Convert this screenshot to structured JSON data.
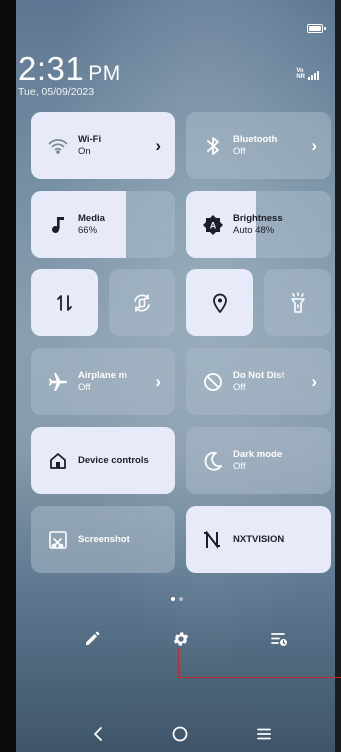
{
  "status_bar": {
    "time": "2:31",
    "ampm": "PM",
    "date": "Tue, 05/09/2023",
    "network": "VoNR"
  },
  "tiles": {
    "wifi": {
      "label": "Wi-Fi",
      "status": "On",
      "icon": "wifi-icon",
      "active": true
    },
    "bluetooth": {
      "label": "Bluetooth",
      "status": "Off",
      "icon": "bluetooth-icon",
      "active": false
    },
    "media": {
      "label": "Media",
      "value": "66%",
      "level": 0.66,
      "icon": "music-note-icon"
    },
    "brightness": {
      "label": "Brightness",
      "value": "Auto 48%",
      "level": 0.48,
      "icon": "brightness-auto-icon"
    },
    "mobile_data": {
      "icon": "data-transfer-icon",
      "active": true
    },
    "auto_rotate": {
      "icon": "auto-rotate-icon",
      "active": false
    },
    "location": {
      "icon": "location-pin-icon",
      "active": true
    },
    "flashlight": {
      "icon": "flashlight-icon",
      "active": false
    },
    "airplane": {
      "label": "Airplane m",
      "status": "Off",
      "icon": "airplane-icon",
      "active": false
    },
    "dnd": {
      "label": "Do Not Dist",
      "status": "Off",
      "icon": "do-not-disturb-icon",
      "active": false
    },
    "device_controls": {
      "label": "Device controls",
      "icon": "home-icon",
      "active": true
    },
    "dark_mode": {
      "label": "Dark mode",
      "status": "Off",
      "icon": "moon-icon",
      "active": false
    },
    "screenshot": {
      "label": "Screenshot",
      "icon": "screenshot-icon",
      "active": false
    },
    "nxtvision": {
      "label": "NXTVISION",
      "icon": "nxtvision-icon",
      "active": true
    }
  },
  "page_indicator": {
    "pages": 2,
    "current": 1
  },
  "bottom_actions": [
    "edit-icon",
    "settings-icon",
    "notification-history-icon"
  ],
  "navigation": [
    "back-icon",
    "home-icon",
    "menu-icon"
  ],
  "colors": {
    "active_tile": "#e7ebf9",
    "annotation": "#c9232a"
  }
}
